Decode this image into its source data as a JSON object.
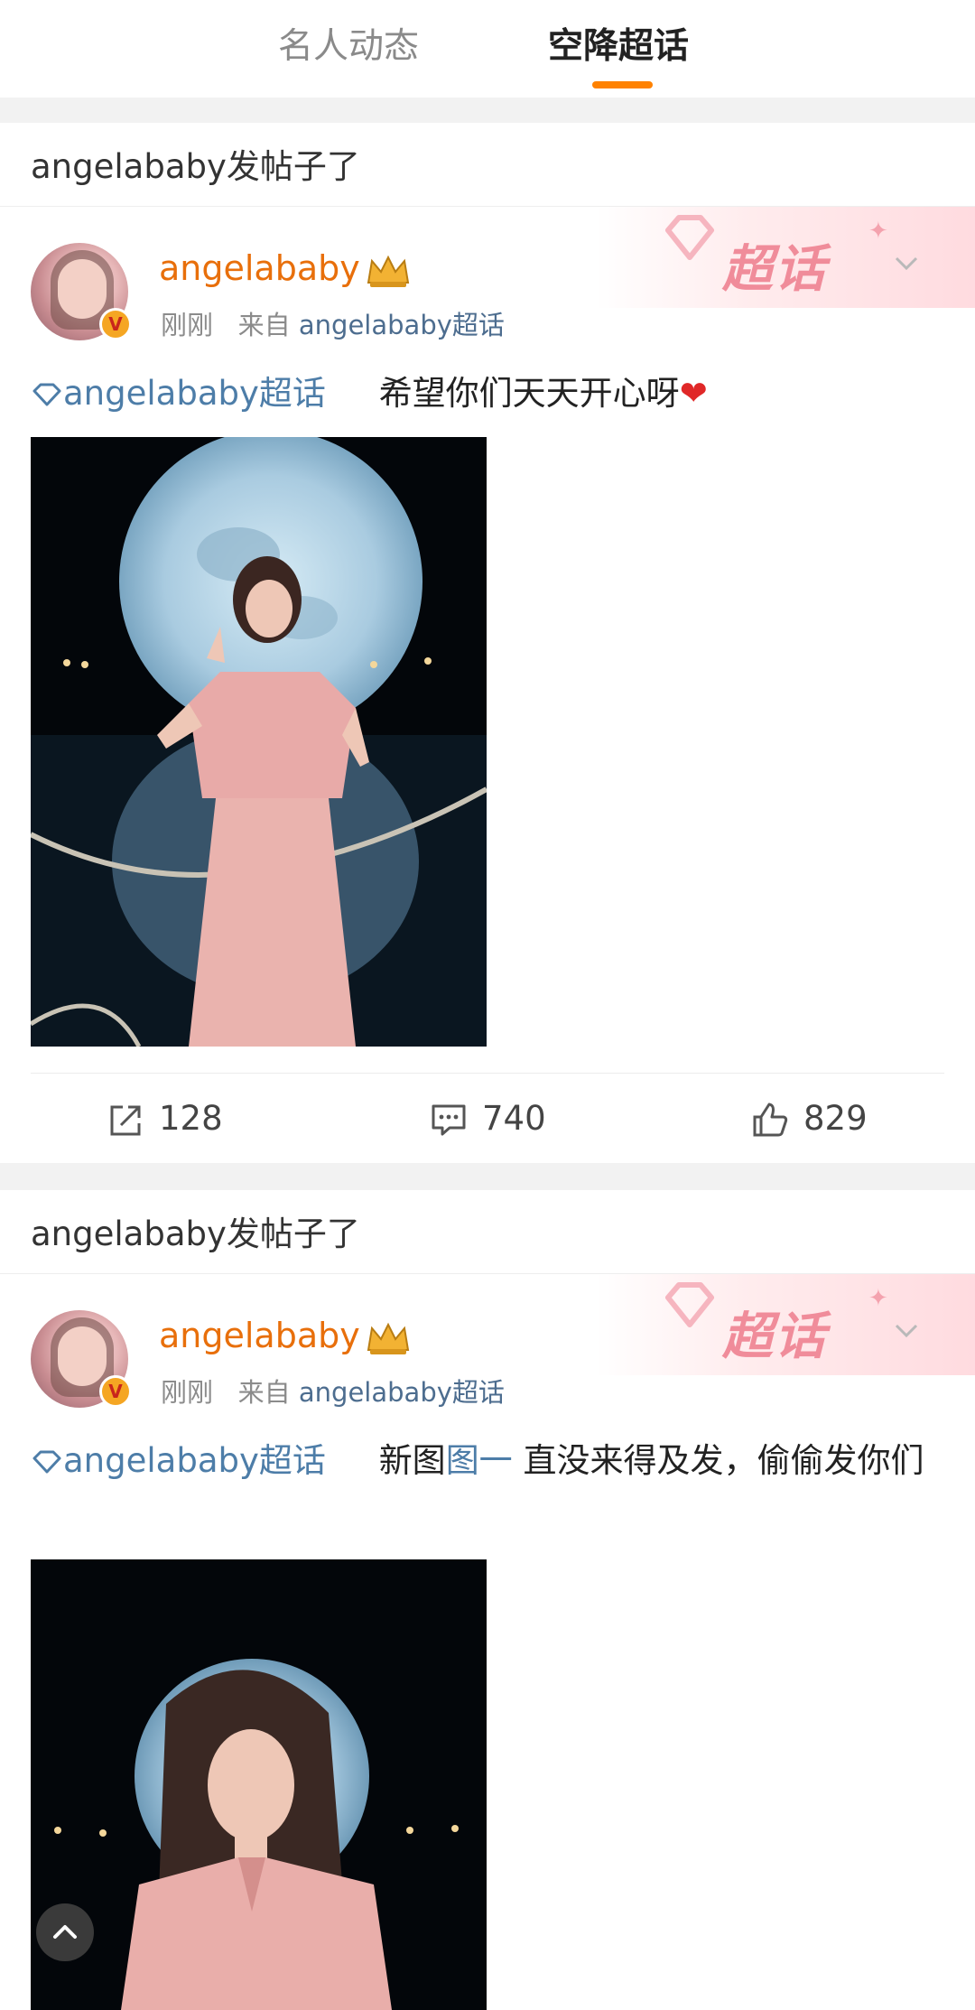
{
  "tabs": {
    "inactive": "名人动态",
    "active": "空降超话"
  },
  "posts": [
    {
      "section_title": "angelababy发帖子了",
      "banner_label": "超话",
      "username": "angelababy",
      "time": "刚刚",
      "source_prefix": "来自",
      "source": "angelababy超话",
      "topic": "angelababy超话",
      "text_main": "希望你们天天开心呀",
      "emoji": "❤",
      "counts": {
        "repost": "128",
        "comment": "740",
        "like": "829"
      }
    },
    {
      "section_title": "angelababy发帖子了",
      "banner_label": "超话",
      "username": "angelababy",
      "time": "刚刚",
      "source_prefix": "来自",
      "source": "angelababy超话",
      "topic": "angelababy超话",
      "text_before_link": "新图",
      "text_link": "图一",
      "text_after_link": " 直没来得及发，偷偷发你们"
    }
  ],
  "colors": {
    "accent": "#ff8200",
    "username": "#e86f0b",
    "link": "#4d7da8"
  },
  "icons": [
    "repost-icon",
    "comment-icon",
    "like-icon",
    "crown-icon",
    "diamond-icon",
    "chevron-down-icon",
    "chevron-up-icon"
  ]
}
